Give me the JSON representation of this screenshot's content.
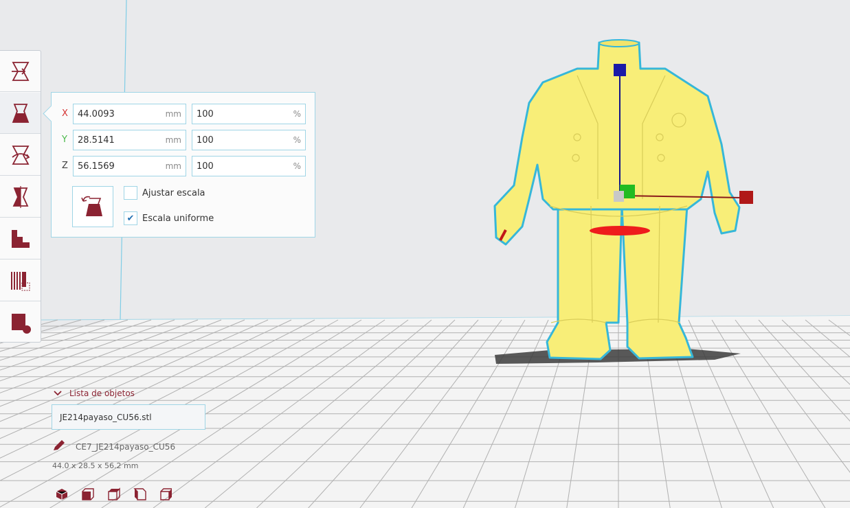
{
  "scale_panel": {
    "axes": [
      {
        "label": "X",
        "color": "#d43232",
        "size": "44.0093",
        "size_unit": "mm",
        "percent": "100",
        "percent_unit": "%"
      },
      {
        "label": "Y",
        "color": "#4ab84a",
        "size": "28.5141",
        "size_unit": "mm",
        "percent": "100",
        "percent_unit": "%"
      },
      {
        "label": "Z",
        "color": "#404040",
        "size": "56.1569",
        "size_unit": "mm",
        "percent": "100",
        "percent_unit": "%"
      }
    ],
    "snap_scaling_label": "Ajustar escala",
    "snap_scaling_checked": false,
    "uniform_scaling_label": "Escala uniforme",
    "uniform_scaling_checked": true
  },
  "toolbar": {
    "tools": [
      "move-tool",
      "scale-tool",
      "rotate-tool",
      "mirror-tool",
      "support-blocker-tool",
      "per-model-settings-tool",
      "custom-supports-tool"
    ],
    "active": "scale-tool",
    "accent_color": "#8b2332"
  },
  "object_list": {
    "header": "Lista de objetos",
    "items": [
      "JE214payaso_CU56.stl"
    ],
    "job_name": "CE7_JE214payaso_CU56",
    "dimensions": "44.0 x 28.5 x 56.2 mm"
  },
  "viewport": {
    "model_color": "#f8ee78",
    "outline_color": "#36b7d9",
    "build_plate_color": "#f4f4f4",
    "grid_color": "#a8a8a8"
  }
}
